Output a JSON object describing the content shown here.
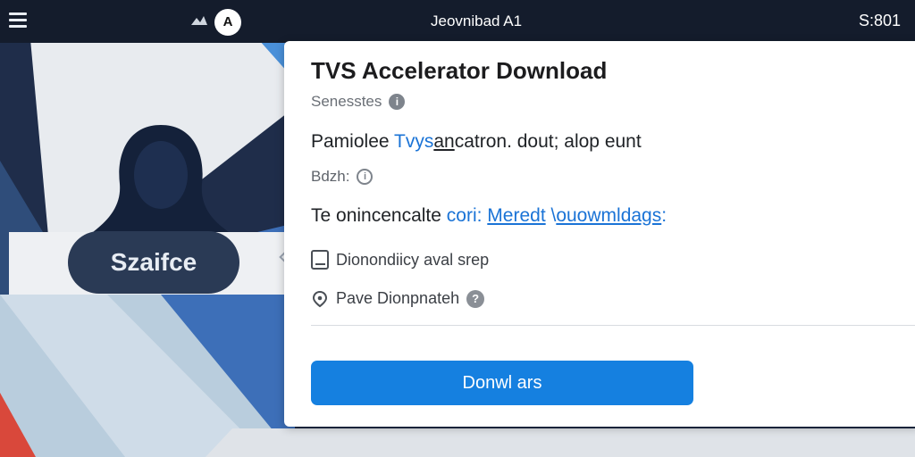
{
  "topbar": {
    "app_title": "Jeovnibad A1",
    "clock": "S:801",
    "logo_letter": "A"
  },
  "profile": {
    "name": "Szaifce"
  },
  "dialog": {
    "title": "TVS Accelerator Download",
    "subtitle": "Senesstes",
    "line1_prefix": "Pamiolee ",
    "line1_link": "Tvys",
    "line1_underlined": "an",
    "line1_rest": "catron. dout; alop eunt",
    "detail_label": "Bdzh:",
    "info_prefix": "Te onincencalte ",
    "info_link1": "cori: ",
    "info_link2": "Meredt",
    "info_link3": "ouowmldags",
    "info_link4": ":",
    "option1_label": "Dionondiicy",
    "option1_suffix": " aval srep",
    "option2_label": "Pave Dionpnateh",
    "help_badge": "?",
    "info_badge": "i",
    "detail_badge": "i",
    "download_button": "Donwl ars"
  },
  "colors": {
    "accent": "#1580e0",
    "topbar": "#141c2c",
    "navy": "#1b2a44",
    "link": "#1a73d6"
  }
}
